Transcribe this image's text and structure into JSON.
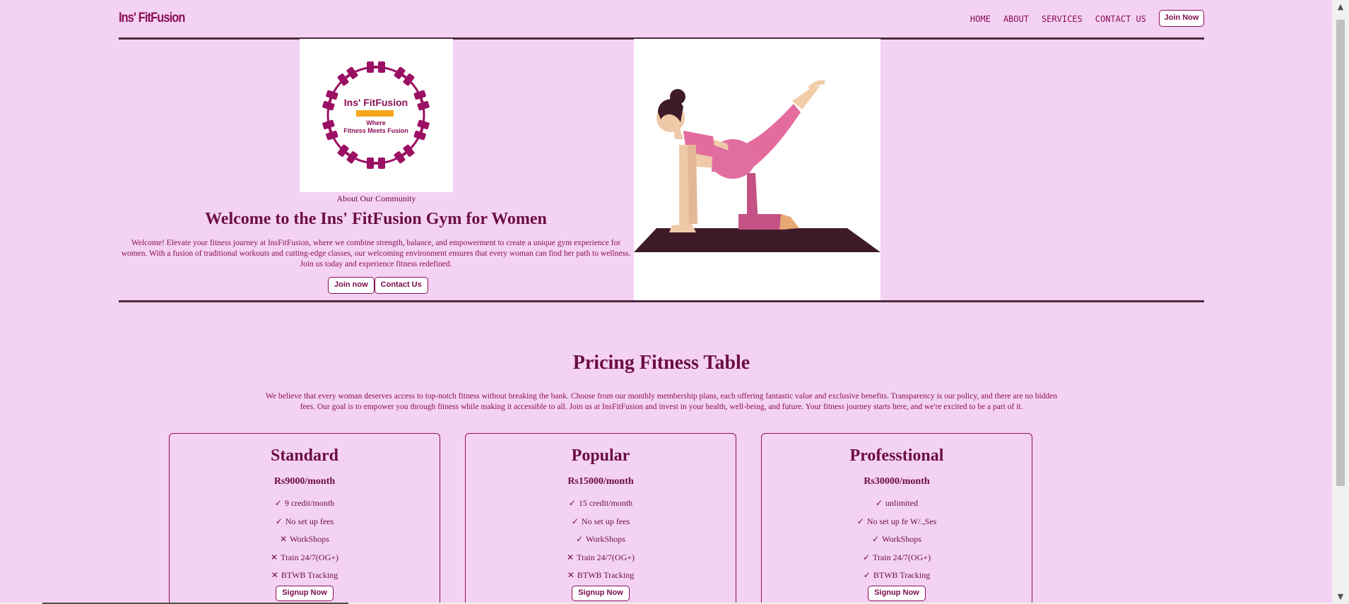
{
  "colors": {
    "background": "#f4d2f3",
    "primary": "#8a0f56",
    "heading": "#6b0d45",
    "divider": "#4d2a3d",
    "button_bg": "#ffffff"
  },
  "header": {
    "brand": "Ins' FitFusion",
    "nav": [
      "HOME",
      "ABOUT",
      "SERVICES",
      "CONTACT US"
    ],
    "join_label": "Join Now"
  },
  "hero": {
    "logo": {
      "name": "Ins' FitFusion",
      "tagline_line1": "Where",
      "tagline_line2": "Fitness Meets Fusion"
    },
    "logo_caption": "About Our Community",
    "title": "Welcome to the Ins' FitFusion Gym for Women",
    "text": "Welcome! Elevate your fitness journey at InsFitFusion, where we combine strength, balance, and empowerment to create a unique gym experience for women. With a fusion of traditional workouts and cutting-edge classes, our welcoming environment ensures that every woman can find her path to wellness. Join us today and experience fitness redefined.",
    "join_label": "Join now",
    "contact_label": "Contact Us",
    "illustration": "woman-yoga-pose-illustration"
  },
  "pricing": {
    "title": "Pricing Fitness Table",
    "text": "We believe that every woman deserves access to top-notch fitness without breaking the bank. Choose from our monthly membership plans, each offering fantastic value and exclusive benefits. Transparency is our policy, and there are no hidden fees. Our goal is to empower you through fitness while making it accessible to all. Join us at InsFitFusion and invest in your health, well-being, and future. Your fitness journey starts here, and we're excited to be a part of it.",
    "plans": [
      {
        "name": "Standard",
        "price": "Rs9000/month",
        "features": [
          {
            "mark": "✓",
            "text": "9 credit/month"
          },
          {
            "mark": "✓",
            "text": "No set up fees"
          },
          {
            "mark": "✕",
            "text": "WorkShops"
          },
          {
            "mark": "✕",
            "text": "Train 24/7(OG+)"
          },
          {
            "mark": "✕",
            "text": "BTWB Tracking"
          }
        ],
        "button": "Signup Now"
      },
      {
        "name": "Popular",
        "price": "Rs15000/month",
        "features": [
          {
            "mark": "✓",
            "text": "15 credit/month"
          },
          {
            "mark": "✓",
            "text": "No set up fees"
          },
          {
            "mark": "✓",
            "text": "WorkShops"
          },
          {
            "mark": "✕",
            "text": "Train 24/7(OG+)"
          },
          {
            "mark": "✕",
            "text": "BTWB Tracking"
          }
        ],
        "button": "Signup Now"
      },
      {
        "name": "Professtional",
        "price": "Rs30000/month",
        "features": [
          {
            "mark": "✓",
            "text": "unlimited"
          },
          {
            "mark": "✓",
            "text": "No set up fe W/.,Ses"
          },
          {
            "mark": "✓",
            "text": "WorkShops"
          },
          {
            "mark": "✓",
            "text": "Train 24/7(OG+)"
          },
          {
            "mark": "✓",
            "text": "BTWB Tracking"
          }
        ],
        "button": "Signup Now"
      }
    ]
  }
}
